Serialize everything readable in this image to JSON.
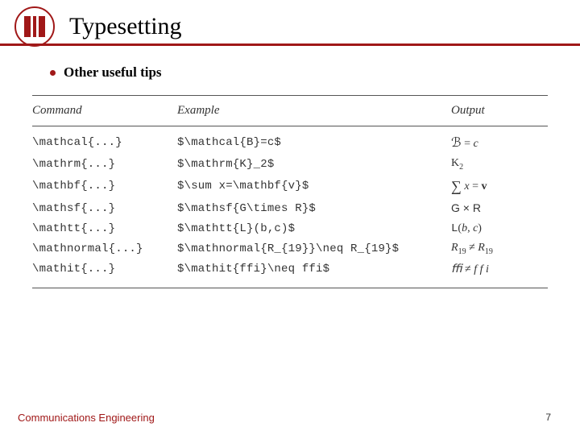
{
  "title": "Typesetting",
  "bullet": "Other useful tips",
  "headers": {
    "command": "Command",
    "example": "Example",
    "output": "Output"
  },
  "rows": [
    {
      "command": "\\mathcal{...}",
      "example": "$\\mathcal{B}=c$",
      "output_html": "<span class='cal'>ℬ</span> = <span class='it'>c</span>"
    },
    {
      "command": "\\mathrm{...}",
      "example": "$\\mathrm{K}_2$",
      "output_html": "<span class='rm'>K</span><sub>2</sub>"
    },
    {
      "command": "\\mathbf{...}",
      "example": "$\\sum x=\\mathbf{v}$",
      "output_html": "<span class='sum'>∑</span> <span class='it'>x</span> = <span class='bf'>v</span>"
    },
    {
      "command": "\\mathsf{...}",
      "example": "$\\mathsf{G\\times R}$",
      "output_html": "<span class='sf'>G × R</span>"
    },
    {
      "command": "\\mathtt{...}",
      "example": "$\\mathtt{L}(b,c)$",
      "output_html": "<span class='tt'>L</span>(<span class='it'>b</span>, <span class='it'>c</span>)"
    },
    {
      "command": "\\mathnormal{...}",
      "example": "$\\mathnormal{R_{19}}\\neq R_{19}$",
      "output_html": "<span class='it'>R</span><sub>19</sub> ≠ <span class='it'>R</span><sub>19</sub>"
    },
    {
      "command": "\\mathit{...}",
      "example": "$\\mathit{ffi}\\neq ffi$",
      "output_html": "<span class='it'>ﬃ</span> ≠ <span class='it'>f f i</span>"
    }
  ],
  "footer": {
    "left": "Communications Engineering",
    "page": "7"
  }
}
